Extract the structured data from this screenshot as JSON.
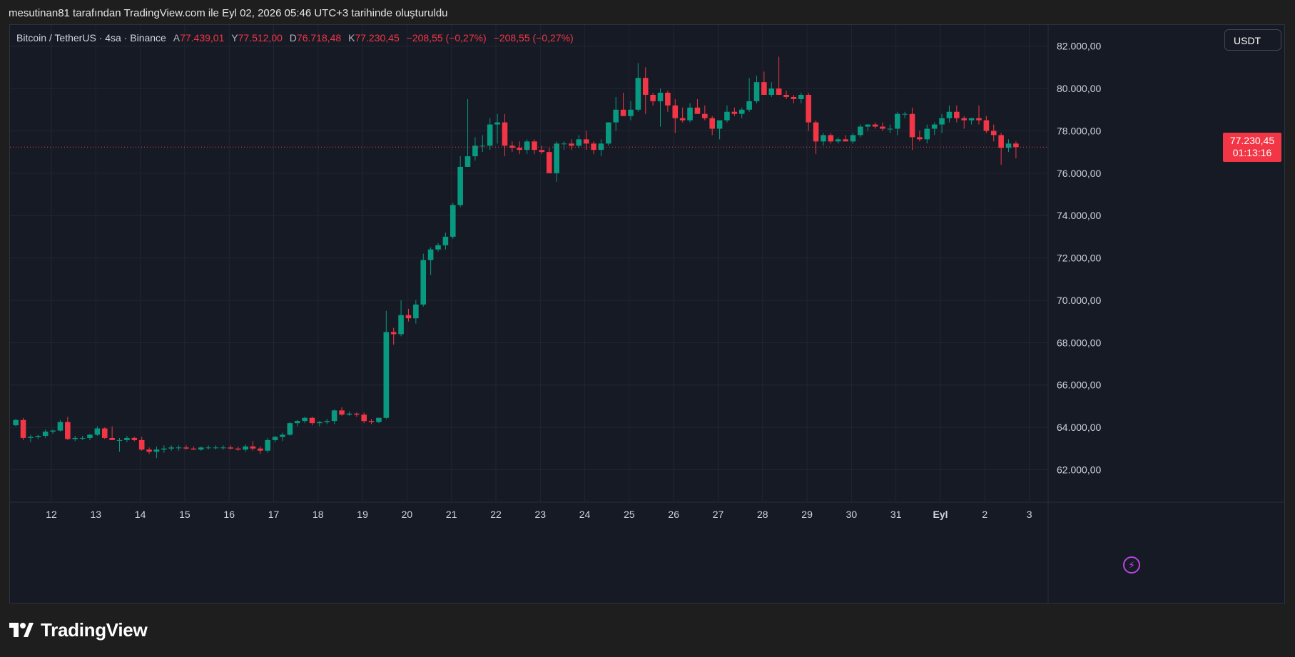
{
  "caption": "mesutinan81 tarafından TradingView.com ile Eyl 02, 2026 05:46 UTC+3 tarihinde oluşturuldu",
  "legend": {
    "symbol": "Bitcoin / TetherUS · 4sa · Binance",
    "open_key": "A",
    "open": "77.439,01",
    "high_key": "Y",
    "high": "77.512,00",
    "low_key": "D",
    "low": "76.718,48",
    "close_key": "K",
    "close": "77.230,45",
    "change": "−208,55 (−0,27%)",
    "change2": "−208,55 (−0,27%)"
  },
  "currency_button": "USDT",
  "last_price": {
    "value": "77.230,45",
    "countdown": "01:13:16"
  },
  "brand": "TradingView",
  "colors": {
    "up": "#089981",
    "down": "#f23645",
    "background": "#161a25",
    "grid": "#232632",
    "axis_text": "#d1d4dc"
  },
  "icons": {
    "bolt": "lightning-bolt-icon",
    "logo": "tradingview-logo-icon"
  },
  "chart_data": {
    "type": "candlestick",
    "interval": "4h",
    "ylim": [
      60500,
      83000
    ],
    "yticks": [
      "62.000,00",
      "64.000,00",
      "66.000,00",
      "68.000,00",
      "70.000,00",
      "72.000,00",
      "74.000,00",
      "76.000,00",
      "78.000,00",
      "80.000,00",
      "82.000,00"
    ],
    "ytick_values": [
      62000,
      64000,
      66000,
      68000,
      70000,
      72000,
      74000,
      76000,
      78000,
      80000,
      82000
    ],
    "xticks": [
      "12",
      "13",
      "14",
      "15",
      "16",
      "17",
      "18",
      "19",
      "20",
      "21",
      "22",
      "23",
      "24",
      "25",
      "26",
      "27",
      "28",
      "29",
      "30",
      "31",
      "Eyl",
      "2",
      "3"
    ],
    "x_start": 11.2,
    "last_price_value": 77230.45,
    "candles": [
      [
        64100,
        64400,
        64050,
        64350
      ],
      [
        64350,
        64450,
        63400,
        63500
      ],
      [
        63500,
        63650,
        63300,
        63550
      ],
      [
        63550,
        63650,
        63450,
        63600
      ],
      [
        63600,
        63900,
        63500,
        63800
      ],
      [
        63800,
        63900,
        63700,
        63850
      ],
      [
        63850,
        64350,
        63800,
        64250
      ],
      [
        64250,
        64500,
        63400,
        63450
      ],
      [
        63450,
        63600,
        63350,
        63500
      ],
      [
        63500,
        63600,
        63400,
        63500
      ],
      [
        63500,
        63700,
        63400,
        63650
      ],
      [
        63650,
        64050,
        63600,
        63950
      ],
      [
        63950,
        64000,
        63450,
        63500
      ],
      [
        63500,
        64050,
        63400,
        63400
      ],
      [
        63400,
        63500,
        62850,
        63400
      ],
      [
        63400,
        63600,
        63300,
        63500
      ],
      [
        63500,
        63550,
        63350,
        63400
      ],
      [
        63400,
        63550,
        62900,
        62950
      ],
      [
        62950,
        63050,
        62750,
        62850
      ],
      [
        62850,
        63100,
        62550,
        62950
      ],
      [
        62950,
        63150,
        62800,
        63000
      ],
      [
        63000,
        63150,
        62900,
        63050
      ],
      [
        63050,
        63150,
        62900,
        63050
      ],
      [
        63050,
        63150,
        62950,
        63000
      ],
      [
        63000,
        63100,
        62950,
        62950
      ],
      [
        62950,
        63100,
        62900,
        63050
      ],
      [
        63050,
        63150,
        62950,
        63050
      ],
      [
        63050,
        63150,
        62950,
        63050
      ],
      [
        63050,
        63150,
        62950,
        63050
      ],
      [
        63050,
        63150,
        62950,
        63000
      ],
      [
        63000,
        63100,
        62900,
        62950
      ],
      [
        62950,
        63200,
        62850,
        63100
      ],
      [
        63100,
        63350,
        62900,
        63000
      ],
      [
        63000,
        63100,
        62750,
        62900
      ],
      [
        62900,
        63500,
        62800,
        63400
      ],
      [
        63400,
        63600,
        63300,
        63550
      ],
      [
        63550,
        63750,
        63350,
        63650
      ],
      [
        63650,
        64250,
        63600,
        64200
      ],
      [
        64200,
        64350,
        64050,
        64300
      ],
      [
        64300,
        64500,
        64200,
        64450
      ],
      [
        64450,
        64500,
        64100,
        64200
      ],
      [
        64200,
        64300,
        64050,
        64250
      ],
      [
        64250,
        64400,
        64150,
        64300
      ],
      [
        64300,
        64850,
        64150,
        64800
      ],
      [
        64800,
        64950,
        64550,
        64600
      ],
      [
        64600,
        64750,
        64550,
        64650
      ],
      [
        64650,
        64700,
        64500,
        64600
      ],
      [
        64600,
        64700,
        64200,
        64300
      ],
      [
        64300,
        64400,
        64150,
        64250
      ],
      [
        64250,
        64450,
        64200,
        64450
      ],
      [
        64450,
        69500,
        64400,
        68500
      ],
      [
        68500,
        68700,
        67900,
        68400
      ],
      [
        68400,
        70000,
        68300,
        69300
      ],
      [
        69300,
        69600,
        69000,
        69150
      ],
      [
        69150,
        70000,
        68900,
        69800
      ],
      [
        69800,
        72200,
        69700,
        71900
      ],
      [
        71900,
        72500,
        71200,
        72400
      ],
      [
        72400,
        72700,
        72300,
        72600
      ],
      [
        72600,
        73200,
        72400,
        73000
      ],
      [
        73000,
        74600,
        72900,
        74500
      ],
      [
        74500,
        76800,
        74400,
        76300
      ],
      [
        76300,
        79500,
        76300,
        76800
      ],
      [
        76800,
        77700,
        76600,
        77300
      ],
      [
        77300,
        77800,
        77000,
        77300
      ],
      [
        77300,
        78600,
        77100,
        78300
      ],
      [
        78300,
        78800,
        77400,
        78400
      ],
      [
        78400,
        78800,
        76800,
        77300
      ],
      [
        77300,
        77500,
        77000,
        77200
      ],
      [
        77200,
        77500,
        76900,
        77100
      ],
      [
        77100,
        77600,
        76900,
        77500
      ],
      [
        77500,
        77600,
        76900,
        77100
      ],
      [
        77100,
        77300,
        76900,
        77000
      ],
      [
        77000,
        77200,
        76000,
        76000
      ],
      [
        76000,
        77500,
        75600,
        77400
      ],
      [
        77400,
        77500,
        77100,
        77400
      ],
      [
        77400,
        77600,
        77100,
        77300
      ],
      [
        77300,
        77800,
        77200,
        77600
      ],
      [
        77600,
        78000,
        77100,
        77400
      ],
      [
        77400,
        77500,
        76900,
        77100
      ],
      [
        77100,
        77600,
        76800,
        77400
      ],
      [
        77400,
        78400,
        77300,
        78400
      ],
      [
        78400,
        79600,
        78000,
        79000
      ],
      [
        79000,
        79800,
        78800,
        78700
      ],
      [
        78700,
        79400,
        78500,
        79000
      ],
      [
        79000,
        81200,
        78900,
        80500
      ],
      [
        80500,
        81000,
        78800,
        79700
      ],
      [
        79700,
        79800,
        79200,
        79400
      ],
      [
        79400,
        80000,
        78200,
        79800
      ],
      [
        79800,
        79900,
        78900,
        79200
      ],
      [
        79200,
        79500,
        77900,
        78600
      ],
      [
        78600,
        79100,
        78400,
        78500
      ],
      [
        78500,
        79300,
        78400,
        79100
      ],
      [
        79100,
        79500,
        78800,
        78800
      ],
      [
        78800,
        79200,
        78500,
        78600
      ],
      [
        78600,
        78700,
        77800,
        78100
      ],
      [
        78100,
        78500,
        77600,
        78500
      ],
      [
        78500,
        79200,
        78400,
        78900
      ],
      [
        78900,
        79100,
        78700,
        78800
      ],
      [
        78800,
        79100,
        78600,
        79000
      ],
      [
        79000,
        80500,
        78900,
        79400
      ],
      [
        79400,
        80600,
        79300,
        80300
      ],
      [
        80300,
        80800,
        79700,
        79700
      ],
      [
        79700,
        80300,
        79600,
        80000
      ],
      [
        80000,
        81500,
        79700,
        79700
      ],
      [
        79700,
        79900,
        79500,
        79600
      ],
      [
        79600,
        79700,
        79300,
        79500
      ],
      [
        79500,
        79800,
        79300,
        79700
      ],
      [
        79700,
        79800,
        78000,
        78400
      ],
      [
        78400,
        78500,
        76900,
        77500
      ],
      [
        77500,
        77900,
        77300,
        77800
      ],
      [
        77800,
        77900,
        77400,
        77500
      ],
      [
        77500,
        77700,
        77400,
        77600
      ],
      [
        77600,
        77800,
        77500,
        77500
      ],
      [
        77500,
        77900,
        77400,
        77800
      ],
      [
        77800,
        78300,
        77700,
        78200
      ],
      [
        78200,
        78300,
        78000,
        78300
      ],
      [
        78300,
        78400,
        78100,
        78200
      ],
      [
        78200,
        78400,
        78000,
        78100
      ],
      [
        78100,
        78300,
        77900,
        78100
      ],
      [
        78100,
        78900,
        77800,
        78800
      ],
      [
        78800,
        78900,
        78600,
        78800
      ],
      [
        78800,
        79100,
        77100,
        77700
      ],
      [
        77700,
        78000,
        77500,
        77600
      ],
      [
        77600,
        78300,
        77400,
        78100
      ],
      [
        78100,
        78400,
        77800,
        78300
      ],
      [
        78300,
        78800,
        77900,
        78600
      ],
      [
        78600,
        79200,
        78400,
        78900
      ],
      [
        78900,
        79200,
        78400,
        78600
      ],
      [
        78600,
        78700,
        78100,
        78500
      ],
      [
        78500,
        78600,
        78300,
        78600
      ],
      [
        78600,
        79200,
        78300,
        78500
      ],
      [
        78500,
        78700,
        77900,
        78000
      ],
      [
        78000,
        78300,
        77500,
        77800
      ],
      [
        77800,
        77900,
        76400,
        77200
      ],
      [
        77200,
        77600,
        77000,
        77400
      ],
      [
        77400,
        77500,
        76700,
        77230
      ]
    ]
  }
}
